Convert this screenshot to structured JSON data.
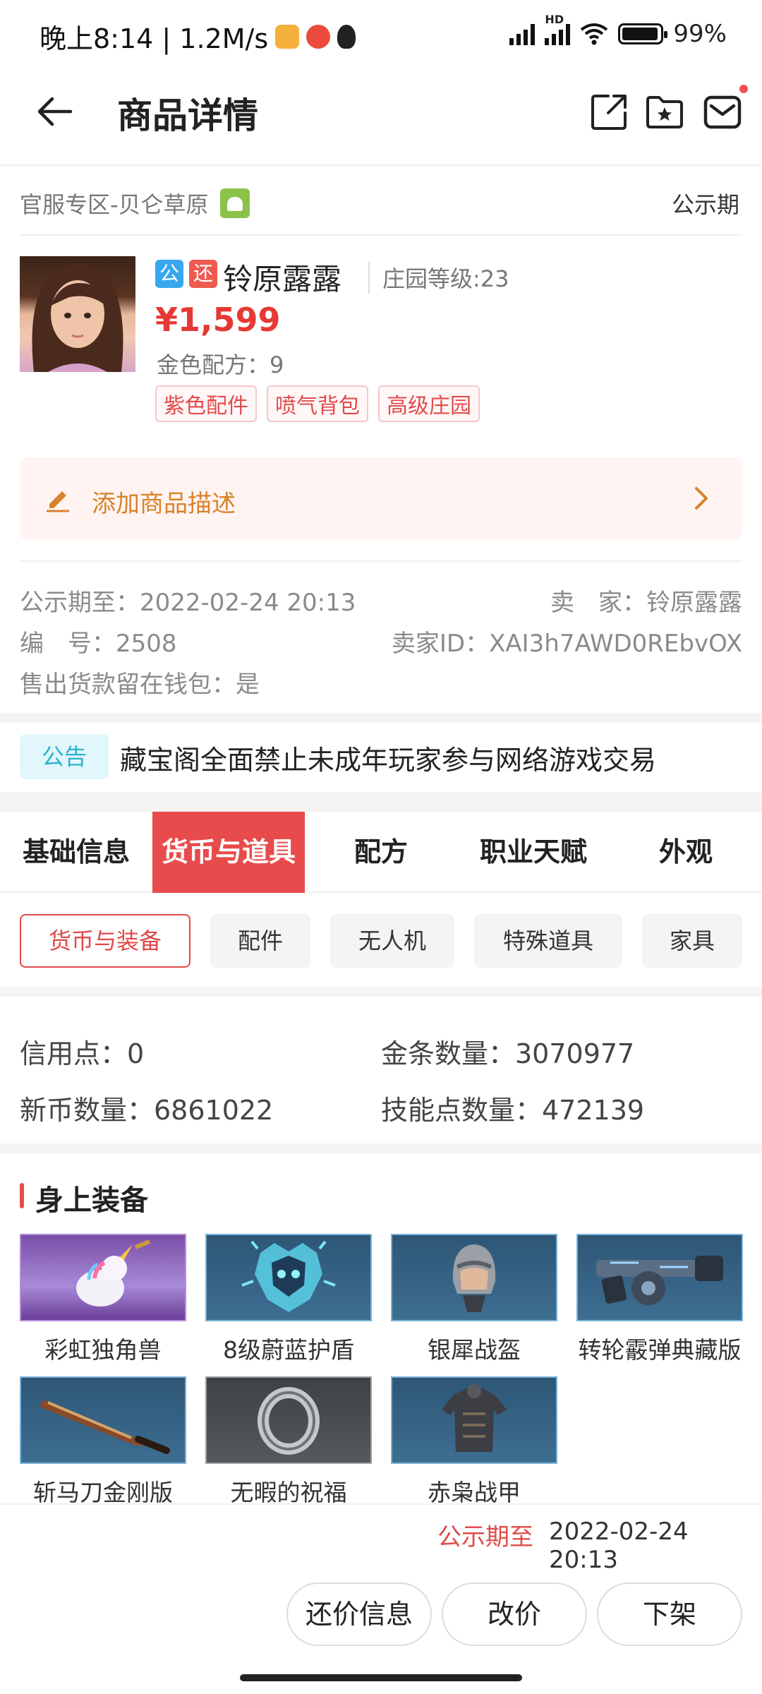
{
  "status": {
    "time_speed": "晚上8:14 | 1.2M/s",
    "network_label": "HD",
    "battery": "99%"
  },
  "header": {
    "title": "商品详情",
    "icons": [
      "back-arrow-icon",
      "share-icon",
      "favorite-folder-icon",
      "message-icon"
    ]
  },
  "server": {
    "name": "官服专区-贝仑草原",
    "platform_icon": "android-icon",
    "status": "公示期"
  },
  "product": {
    "badge_public": "公",
    "badge_bargain": "还",
    "name": "铃原露露",
    "level": "庄园等级:23",
    "price": "¥1,599",
    "recipe": "金色配方：9",
    "tags": [
      "紫色配件",
      "喷气背包",
      "高级庄园"
    ]
  },
  "description": {
    "label": "添加商品描述"
  },
  "info": {
    "period": "公示期至：2022-02-24 20:13",
    "seller": "卖　家：铃原露露",
    "number": "编　号：2508",
    "seller_id": "卖家ID：XAI3h7AWD0REbvOX",
    "wallet": "售出货款留在钱包：是"
  },
  "announcement": {
    "badge": "公告",
    "text": "藏宝阁全面禁止未成年玩家参与网络游戏交易"
  },
  "tabs": [
    "基础信息",
    "货币与道具",
    "配方",
    "职业天赋",
    "外观"
  ],
  "active_tab": "货币与道具",
  "sub_tabs": [
    "货币与装备",
    "配件",
    "无人机",
    "特殊道具",
    "家具"
  ],
  "active_sub_tab": "货币与装备",
  "stats": {
    "credit": "信用点：0",
    "gold": "金条数量：3070977",
    "coins": "新币数量：6861022",
    "skill": "技能点数量：472139"
  },
  "equipment": {
    "title": "身上装备",
    "items": [
      "彩虹独角兽",
      "8级蔚蓝护盾",
      "银犀战盔",
      "转轮霰弹典藏版",
      "斩马刀金刚版",
      "无暇的祝福",
      "赤枭战甲"
    ]
  },
  "footer": {
    "period_label": "公示期至",
    "period_value": "2022-02-24 20:13",
    "buttons": [
      "还价信息",
      "改价",
      "下架"
    ]
  },
  "colors": {
    "accent": "#e84b4b",
    "price": "#e53935",
    "announcement": "#2bb2cc",
    "description": "#d9822b"
  }
}
